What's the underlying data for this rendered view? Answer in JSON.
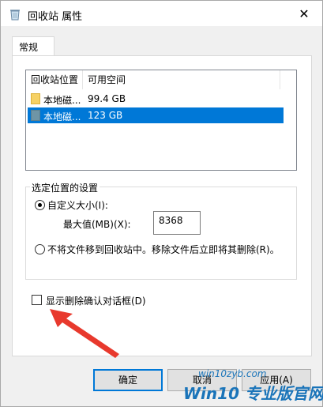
{
  "window": {
    "title": "回收站 属性",
    "close_glyph": "✕"
  },
  "tabs": [
    {
      "label": "常规"
    }
  ],
  "listview": {
    "columns": [
      "回收站位置",
      "可用空间"
    ],
    "rows": [
      {
        "name": "本地磁...",
        "space": "99.4 GB",
        "selected": false
      },
      {
        "name": "本地磁...",
        "space": "123 GB",
        "selected": true
      }
    ]
  },
  "settings_group": {
    "label": "选定位置的设置",
    "custom_size_label": "自定义大小(I):",
    "max_value_label": "最大值(MB)(X):",
    "max_value": "8368",
    "no_move_label": "不将文件移到回收站中。移除文件后立即将其删除(R)。"
  },
  "confirm_checkbox": {
    "label": "显示删除确认对话框(D)",
    "checked": false
  },
  "buttons": {
    "ok": "确定",
    "cancel": "取消",
    "apply": "应用(A)"
  },
  "watermark": {
    "site": "win10zyb.com",
    "brand": "Win10 专业版官网"
  },
  "colors": {
    "selection": "#0078d7",
    "arrow": "#e8392d"
  }
}
